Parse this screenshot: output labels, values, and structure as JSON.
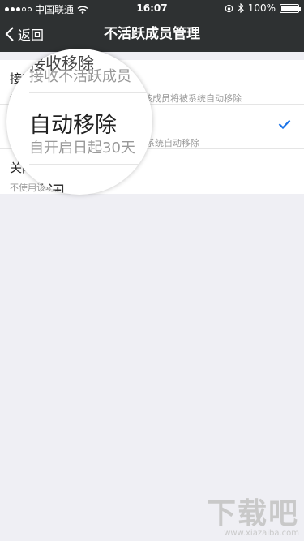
{
  "status_bar": {
    "carrier": "中国联通",
    "time": "16:07",
    "battery": "100%",
    "battery_level": 1.0
  },
  "nav": {
    "back_label": "返回",
    "title": "不活跃成员管理"
  },
  "settings": {
    "rows": [
      {
        "label": "接收不活跃成员",
        "desc": "群主接收不活跃成员通知，开启后该成员将被系统自动移除",
        "selected": false
      },
      {
        "label": "自动移除",
        "desc": "自开启日起30天不活跃该成员将被系统自动移除",
        "selected": true
      },
      {
        "label": "关闭",
        "desc": "不使用该功能",
        "selected": false
      }
    ]
  },
  "magnifier": {
    "top_text": "接收移除",
    "sub1": "接收不活跃成员",
    "title": "自动移除",
    "sub2": "自开启日起30天",
    "bottom_text": "关闭"
  },
  "watermark": {
    "big": "下载吧",
    "small": "www.xiazaiba.com"
  },
  "colors": {
    "nav_bg": "#2e3132",
    "page_bg": "#efeff4",
    "check": "#1a73e8"
  }
}
